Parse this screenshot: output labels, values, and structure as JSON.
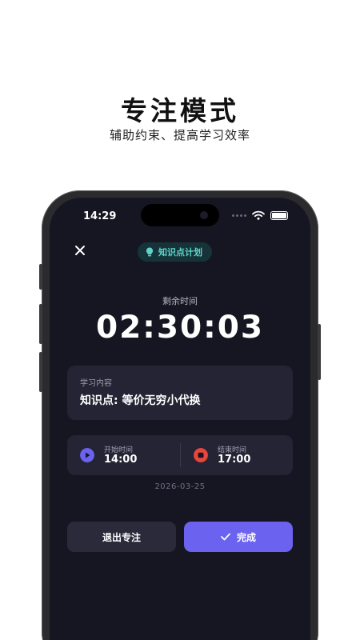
{
  "promo": {
    "title": "专注模式",
    "subtitle": "辅助约束、提高学习效率"
  },
  "status_bar": {
    "time": "14:29"
  },
  "header": {
    "close_icon": "close-icon",
    "chip_label": "知识点计划",
    "chip_icon": "lightbulb-icon"
  },
  "timer": {
    "label": "剩余时间",
    "value": "02:30:03"
  },
  "content": {
    "label": "学习内容",
    "text": "知识点: 等价无穷小代换"
  },
  "schedule": {
    "start_label": "开始时间",
    "start_time": "14:00",
    "end_label": "结束时间",
    "end_time": "17:00",
    "date": "2026-03-25"
  },
  "actions": {
    "exit_label": "退出专注",
    "done_label": "完成"
  },
  "colors": {
    "background": "#161623",
    "card": "#242434",
    "accent": "#6b62f0",
    "chip_text": "#5fd3c8",
    "start_icon": "#6b62f0",
    "end_icon": "#e8453c"
  }
}
